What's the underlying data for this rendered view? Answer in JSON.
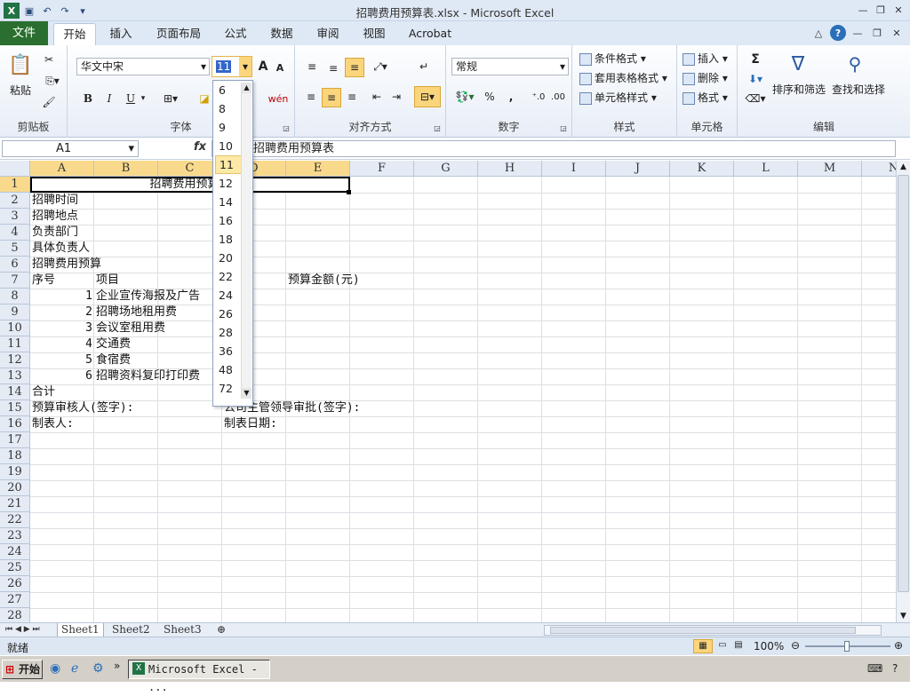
{
  "window": {
    "title": "招聘费用预算表.xlsx - Microsoft Excel"
  },
  "tabs": [
    "文件",
    "开始",
    "插入",
    "页面布局",
    "公式",
    "数据",
    "审阅",
    "视图",
    "Acrobat"
  ],
  "ribbon": {
    "clipboard": {
      "label": "剪贴板",
      "paste": "粘贴"
    },
    "font": {
      "label": "字体",
      "name": "华文中宋",
      "size": "11",
      "bold": "B",
      "italic": "I",
      "underline": "U",
      "grow": "A",
      "shrink": "A",
      "wen": "wén"
    },
    "alignment": {
      "label": "对齐方式"
    },
    "number": {
      "label": "数字",
      "format": "常规",
      "percent": "%",
      "comma": ","
    },
    "styles": {
      "label": "样式",
      "cond": "条件格式",
      "table": "套用表格格式",
      "cell": "单元格样式"
    },
    "cells": {
      "label": "单元格",
      "insert": "插入",
      "delete": "删除",
      "format": "格式"
    },
    "editing": {
      "label": "编辑",
      "sum": "Σ",
      "sort": "排序和筛选",
      "find": "查找和选择"
    }
  },
  "formula": {
    "name_box": "A1",
    "fx": "fx",
    "content": "招聘费用预算表"
  },
  "font_size_dropdown": {
    "options": [
      "6",
      "8",
      "9",
      "10",
      "11",
      "12",
      "14",
      "16",
      "18",
      "20",
      "22",
      "24",
      "26",
      "28",
      "36",
      "48",
      "72"
    ],
    "selected": "11"
  },
  "columns": [
    "A",
    "B",
    "C",
    "D",
    "E",
    "F",
    "G",
    "H",
    "I",
    "J",
    "K",
    "L",
    "M",
    "N"
  ],
  "rows": [
    "1",
    "2",
    "3",
    "4",
    "5",
    "6",
    "7",
    "8",
    "9",
    "10",
    "11",
    "12",
    "13",
    "14",
    "15",
    "16",
    "17",
    "18",
    "19",
    "20",
    "21",
    "22",
    "23",
    "24",
    "25",
    "26",
    "27",
    "28"
  ],
  "cells": {
    "r1": "招聘费用预算表",
    "a2": "招聘时间",
    "a3": "招聘地点",
    "a4": "负责部门",
    "a5": "具体负责人",
    "a6": "招聘费用预算",
    "a7": "序号",
    "b7": "项目",
    "e7": "预算金额(元)",
    "a8": "1",
    "b8": "企业宣传海报及广告",
    "a9": "2",
    "b9": "招聘场地租用费",
    "a10": "3",
    "b10": "会议室租用费",
    "a11": "4",
    "b11": "交通费",
    "a12": "5",
    "b12": "食宿费",
    "a13": "6",
    "b13": "招聘资料复印打印费",
    "a14": "合计",
    "a15": "预算审核人(签字):",
    "d15": "公司主管领导审批(签字):",
    "a16": "制表人:",
    "d16": "制表日期:"
  },
  "sheets": [
    "Sheet1",
    "Sheet2",
    "Sheet3"
  ],
  "status": {
    "ready": "就绪",
    "zoom": "100%"
  },
  "taskbar": {
    "start": "开始",
    "item": "Microsoft Excel - ..."
  }
}
